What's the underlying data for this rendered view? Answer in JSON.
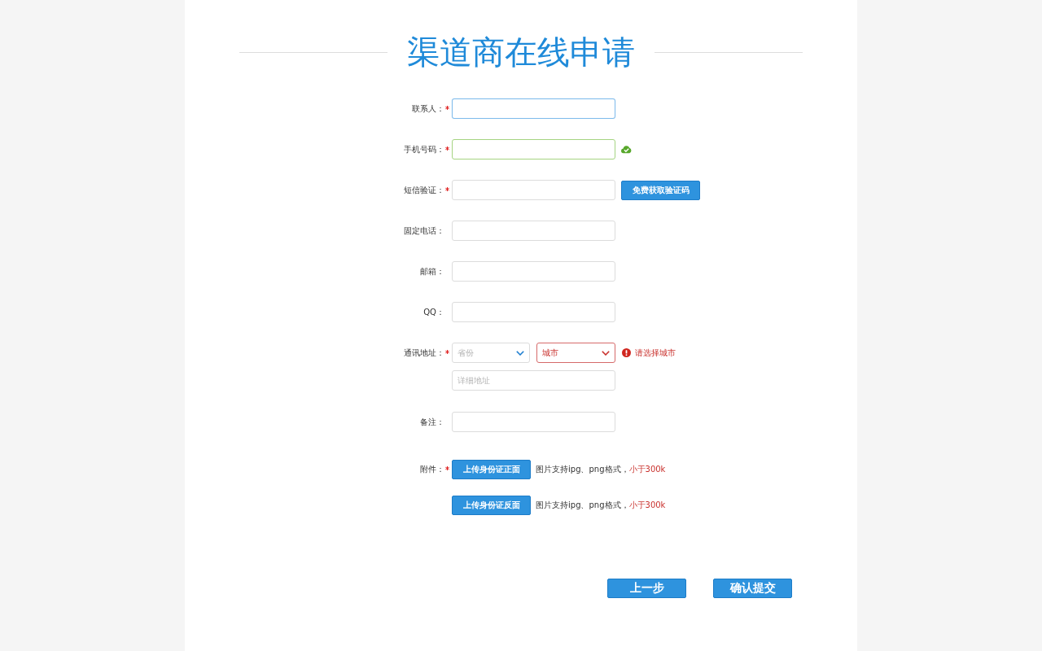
{
  "title": "渠道商在线申请",
  "fields": [
    {
      "kind": "text",
      "label": "联系人：",
      "required": true,
      "focused": true,
      "valid": false
    },
    {
      "kind": "text",
      "label": "手机号码：",
      "required": true,
      "focused": false,
      "valid": true
    },
    {
      "kind": "text",
      "label": "短信验证：",
      "required": true,
      "focused": false,
      "valid": false,
      "button": "免费获取验证码"
    },
    {
      "kind": "text",
      "label": "固定电话：",
      "required": false,
      "focused": false,
      "valid": false
    },
    {
      "kind": "text",
      "label": "邮箱：",
      "required": false,
      "focused": false,
      "valid": false
    },
    {
      "kind": "text",
      "label": "QQ：",
      "required": false,
      "focused": false,
      "valid": false
    },
    {
      "kind": "address",
      "label": "通讯地址：",
      "required": true,
      "selects": [
        {
          "text": "省份",
          "error": false
        },
        {
          "text": "城市",
          "error": true
        }
      ],
      "error": "请选择城市",
      "detail": {
        "placeholder": "详细地址"
      }
    },
    {
      "kind": "text",
      "label": "备注：",
      "required": false,
      "focused": false,
      "valid": false
    },
    {
      "kind": "upload",
      "label": "附件：",
      "required": true,
      "uploads": [
        {
          "button": "上传身份证正面",
          "hint": "图片支持ipg、png格式，",
          "note": "小于300k"
        },
        {
          "button": "上传身份证反面",
          "hint": "图片支持ipg、png格式，",
          "note": "小于300k"
        }
      ]
    }
  ],
  "actions": [
    "上一步",
    "确认提交"
  ]
}
